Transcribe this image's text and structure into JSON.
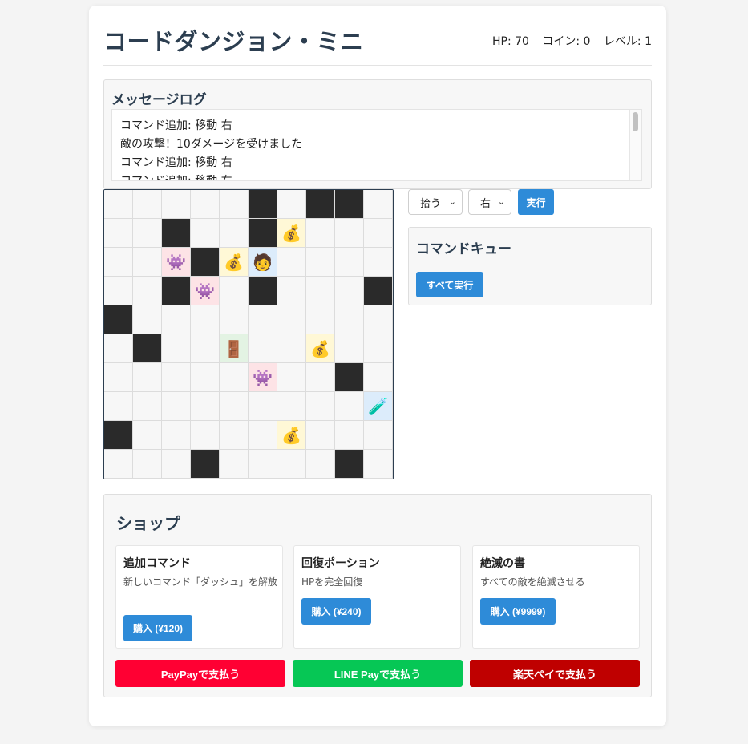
{
  "header": {
    "title": "コードダンジョン・ミニ",
    "hp": "HP: 70",
    "coins": "コイン: 0",
    "level": "レベル: 1"
  },
  "log": {
    "title": "メッセージログ",
    "lines": [
      "コマンド追加: 移動 右",
      "敵の攻撃！10ダメージを受けました",
      "コマンド追加: 移動 右",
      "コマンド追加: 移動 右"
    ]
  },
  "board": {
    "legend": {
      "coin": "money-bag-icon",
      "enemy": "space-invader-icon",
      "player": "person-icon",
      "exit": "door-icon",
      "potion": "potion-icon",
      "wall": "wall"
    },
    "rows": [
      [
        "",
        "",
        "",
        "",
        "",
        "wall",
        "",
        "wall",
        "wall",
        ""
      ],
      [
        "",
        "",
        "wall",
        "",
        "",
        "wall",
        "coin",
        "",
        "",
        ""
      ],
      [
        "",
        "",
        "enemy",
        "wall",
        "coin",
        "player",
        "",
        "",
        "",
        ""
      ],
      [
        "",
        "",
        "wall",
        "enemy",
        "",
        "wall",
        "",
        "",
        "",
        "wall"
      ],
      [
        "wall",
        "",
        "",
        "",
        "",
        "",
        "",
        "",
        "",
        ""
      ],
      [
        "",
        "wall",
        "",
        "",
        "exit",
        "",
        "",
        "coin",
        "",
        ""
      ],
      [
        "",
        "",
        "",
        "",
        "",
        "enemy",
        "",
        "",
        "wall",
        ""
      ],
      [
        "",
        "",
        "",
        "",
        "",
        "",
        "",
        "",
        "",
        "potion"
      ],
      [
        "wall",
        "",
        "",
        "",
        "",
        "",
        "coin",
        "",
        "",
        ""
      ],
      [
        "",
        "",
        "",
        "wall",
        "",
        "",
        "",
        "",
        "wall",
        ""
      ]
    ]
  },
  "controls": {
    "action_value": "拾う",
    "direction_value": "右",
    "execute_label": "実行"
  },
  "queue": {
    "title": "コマンドキュー",
    "run_all_label": "すべて実行"
  },
  "shop": {
    "title": "ショップ",
    "items": [
      {
        "name": "追加コマンド",
        "desc": "新しいコマンド「ダッシュ」を解放",
        "button": "購入 (¥120)"
      },
      {
        "name": "回復ポーション",
        "desc": "HPを完全回復",
        "button": "購入 (¥240)"
      },
      {
        "name": "絶滅の書",
        "desc": "すべての敵を絶滅させる",
        "button": "購入 (¥9999)"
      }
    ],
    "payments": [
      {
        "label": "PayPayで支払う",
        "color": "#ff0033"
      },
      {
        "label": "LINE Payで支払う",
        "color": "#06c755"
      },
      {
        "label": "楽天ペイで支払う",
        "color": "#bf0000"
      }
    ]
  },
  "colors": {
    "accent": "#2e8bd8",
    "wall": "#2a2a2a",
    "coin_cell": "#fff8d6",
    "enemy_cell": "#fde3e6",
    "player_cell": "#dcecfb",
    "exit_cell": "#e3f3e3"
  }
}
